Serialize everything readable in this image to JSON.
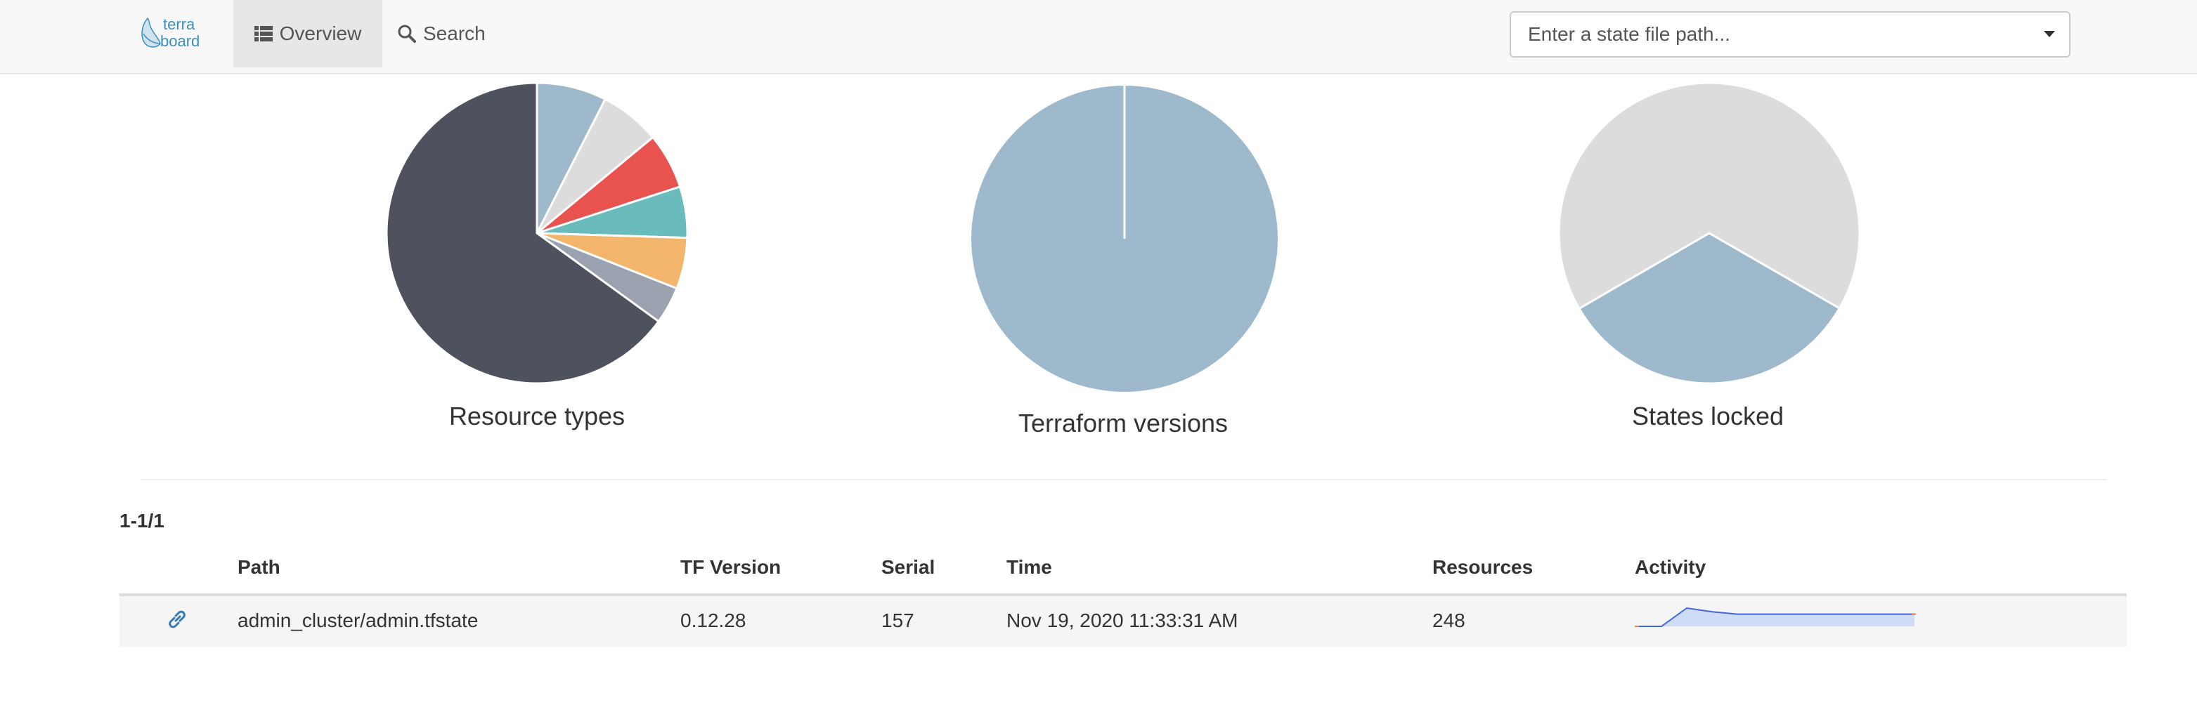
{
  "nav": {
    "logo_top": "terra",
    "logo_bottom": "board",
    "overview_label": "Overview",
    "search_label": "Search",
    "state_path_placeholder": "Enter a state file path..."
  },
  "charts": [
    {
      "title": "Resource types",
      "chart_data": {
        "type": "pie",
        "values": [
          7.5,
          6.5,
          6.0,
          5.5,
          5.5,
          4.0,
          65.0
        ],
        "colors": [
          "#9eb9cb",
          "#dcdcdc",
          "#e85350",
          "#69bcbb",
          "#f3b56b",
          "#9aa1af",
          "#4e525e"
        ]
      }
    },
    {
      "title": "Terraform versions",
      "chart_data": {
        "type": "pie",
        "values": [
          100
        ],
        "colors": [
          "#9eb9cb"
        ]
      }
    },
    {
      "title": "States locked",
      "chart_data": {
        "type": "pie",
        "values": [
          33.3,
          66.7
        ],
        "start_angle": 120,
        "colors": [
          "#9eb9cb",
          "#dcdcdc"
        ]
      }
    }
  ],
  "table": {
    "pager": "1-1/1",
    "headers": {
      "path": "Path",
      "tf_version": "TF Version",
      "serial": "Serial",
      "time": "Time",
      "resources": "Resources",
      "activity": "Activity"
    },
    "rows": [
      {
        "path": "admin_cluster/admin.tfstate",
        "tf_version": "0.12.28",
        "serial": "157",
        "time": "Nov 19, 2020 11:33:31 AM",
        "resources": "248",
        "activity": [
          0,
          0,
          15,
          12,
          10,
          10,
          10,
          10,
          10,
          10,
          10,
          10
        ]
      }
    ]
  },
  "colors": {
    "accent": "#337ab7",
    "sparkline_line": "#4466dd",
    "sparkline_fill": "#cfdcf8",
    "sparkline_marker": "#e8814a"
  }
}
